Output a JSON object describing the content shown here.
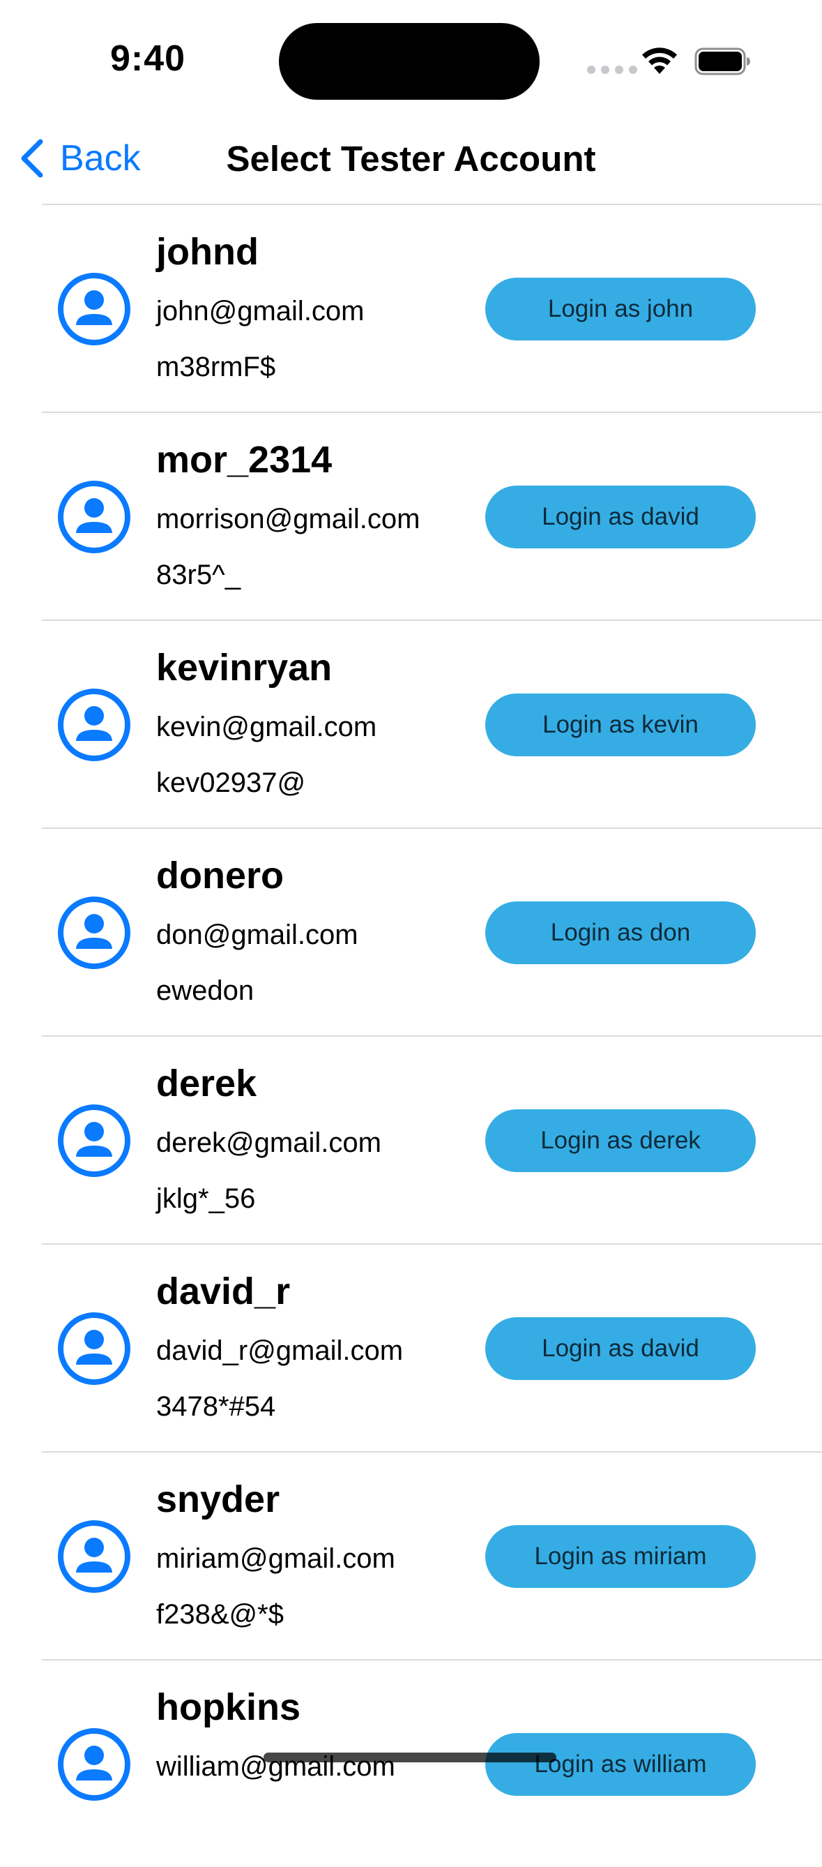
{
  "status_bar": {
    "time": "9:40"
  },
  "nav": {
    "back_label": "Back",
    "title": "Select Tester Account"
  },
  "icons": {
    "back": "chevron-left-icon",
    "avatar": "person-circle-icon",
    "wifi": "wifi-icon",
    "battery": "battery-icon"
  },
  "colors": {
    "accent": "#0a7aff",
    "button": "#35ade4",
    "button_text": "#0d2a3a",
    "separator": "#dcdcde"
  },
  "accounts": [
    {
      "username": "johnd",
      "email": "john@gmail.com",
      "password": "m38rmF$",
      "button_label": "Login as john"
    },
    {
      "username": "mor_2314",
      "email": "morrison@gmail.com",
      "password": "83r5^_",
      "button_label": "Login as david"
    },
    {
      "username": "kevinryan",
      "email": "kevin@gmail.com",
      "password": "kev02937@",
      "button_label": "Login as kevin"
    },
    {
      "username": "donero",
      "email": "don@gmail.com",
      "password": "ewedon",
      "button_label": "Login as don"
    },
    {
      "username": "derek",
      "email": "derek@gmail.com",
      "password": "jklg*_56",
      "button_label": "Login as derek"
    },
    {
      "username": "david_r",
      "email": "david_r@gmail.com",
      "password": "3478*#54",
      "button_label": "Login as david"
    },
    {
      "username": "snyder",
      "email": "miriam@gmail.com",
      "password": "f238&@*$",
      "button_label": "Login as miriam"
    },
    {
      "username": "hopkins",
      "email": "william@gmail.com",
      "password": "",
      "button_label": "Login as william"
    }
  ]
}
